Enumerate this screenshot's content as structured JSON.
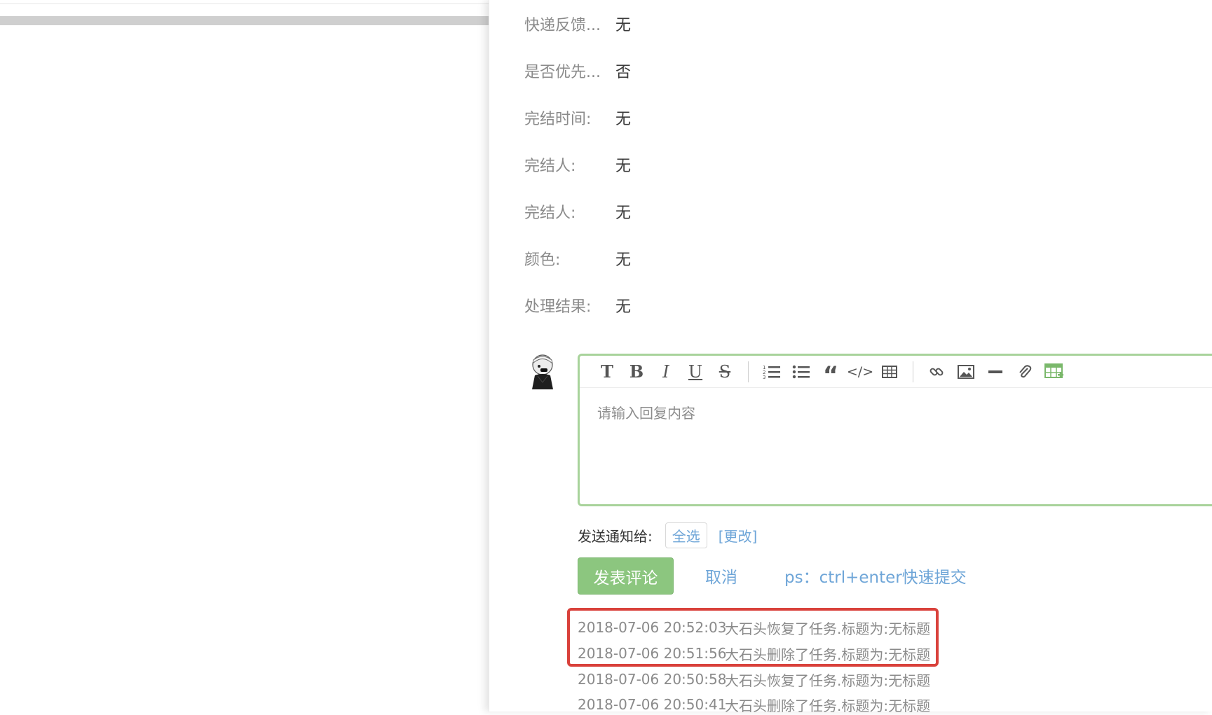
{
  "fields": [
    {
      "label": "快递反馈...",
      "value": "无"
    },
    {
      "label": "是否优先...",
      "value": "否"
    },
    {
      "label": "完结时间:",
      "value": "无"
    },
    {
      "label": "完结人:",
      "value": "无"
    },
    {
      "label": "完结人:",
      "value": "无"
    },
    {
      "label": "颜色:",
      "value": "无"
    },
    {
      "label": "处理结果:",
      "value": "无"
    }
  ],
  "editor": {
    "placeholder": "请输入回复内容",
    "toolbar_icons": [
      "heading-icon",
      "bold-icon",
      "italic-icon",
      "underline-icon",
      "strikethrough-icon",
      "ordered-list-icon",
      "unordered-list-icon",
      "quote-icon",
      "code-icon",
      "table-icon",
      "link-icon",
      "image-icon",
      "horizontal-rule-icon",
      "attachment-icon",
      "insert-table-icon"
    ],
    "accent": "#a8d39b"
  },
  "notify": {
    "label": "发送通知给:",
    "select_all": "全选",
    "change": "[更改]"
  },
  "actions": {
    "submit": "发表评论",
    "cancel": "取消",
    "hint": "ps：ctrl+enter快速提交"
  },
  "logs": [
    {
      "time": "2018-07-06 20:52:03",
      "text": "大石头恢复了任务.标题为:无标题"
    },
    {
      "time": "2018-07-06 20:51:56",
      "text": "大石头删除了任务.标题为:无标题"
    },
    {
      "time": "2018-07-06 20:50:58",
      "text": "大石头恢复了任务.标题为:无标题"
    },
    {
      "time": "2018-07-06 20:50:41",
      "text": "大石头删除了任务.标题为:无标题"
    }
  ],
  "colors": {
    "link": "#6fa6d8",
    "primary_button": "#8cc67f",
    "highlight": "#d9413b"
  }
}
